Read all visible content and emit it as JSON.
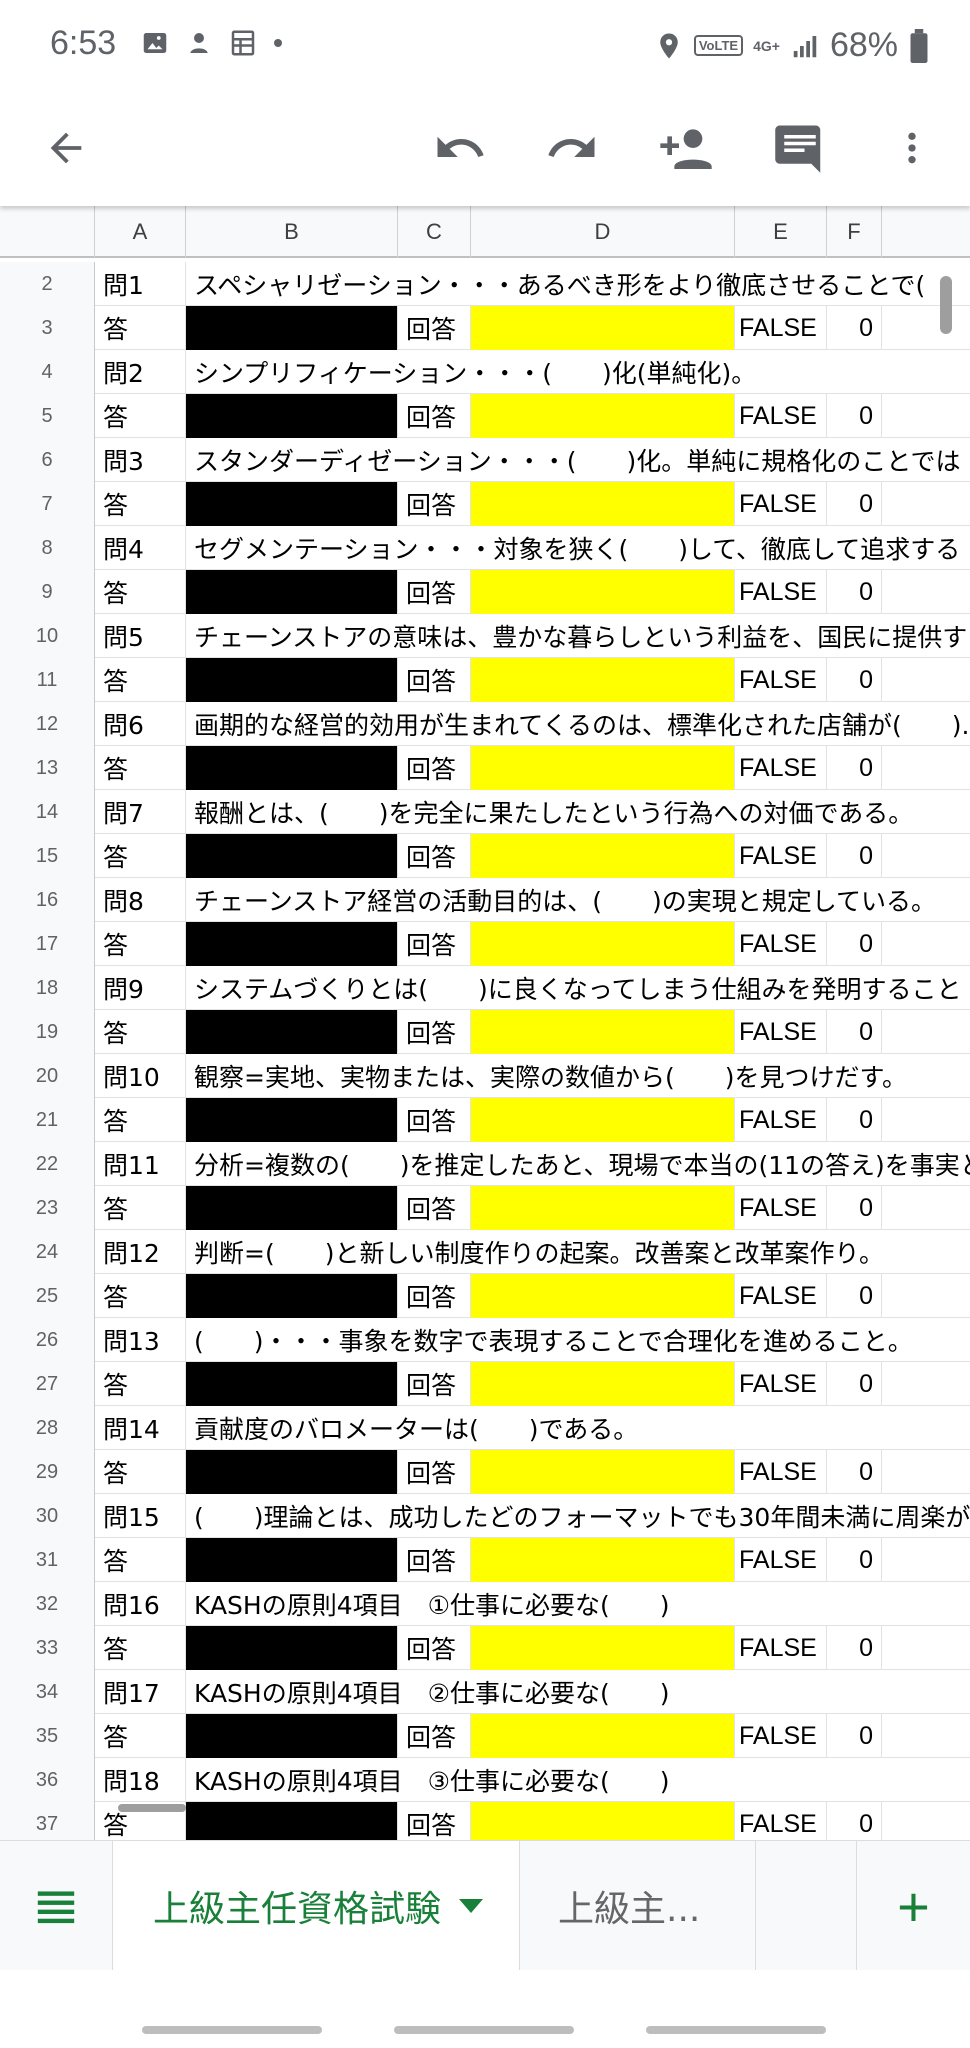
{
  "status_bar": {
    "time": "6:53",
    "volte": "VoLTE",
    "network": "4G+",
    "battery": "68%"
  },
  "columns": [
    "A",
    "B",
    "C",
    "D",
    "E",
    "F"
  ],
  "rows": [
    {
      "n": "2",
      "type": "q",
      "a": "問1",
      "text": "スペシャリゼーション・・・あるべき形をより徹底させることで("
    },
    {
      "n": "3",
      "type": "a",
      "a": "答",
      "c": "回答",
      "e": "FALSE",
      "f": "0"
    },
    {
      "n": "4",
      "type": "q",
      "a": "問2",
      "text": "シンプリフィケーション・・・(　　)化(単純化)。"
    },
    {
      "n": "5",
      "type": "a",
      "a": "答",
      "c": "回答",
      "e": "FALSE",
      "f": "0"
    },
    {
      "n": "6",
      "type": "q",
      "a": "問3",
      "text": "スタンダーディゼーション・・・(　　)化。単純に規格化のことでは"
    },
    {
      "n": "7",
      "type": "a",
      "a": "答",
      "c": "回答",
      "e": "FALSE",
      "f": "0"
    },
    {
      "n": "8",
      "type": "q",
      "a": "問4",
      "text": "セグメンテーション・・・対象を狭く(　　)して、徹底して追求する"
    },
    {
      "n": "9",
      "type": "a",
      "a": "答",
      "c": "回答",
      "e": "FALSE",
      "f": "0"
    },
    {
      "n": "10",
      "type": "q",
      "a": "問5",
      "text": "チェーンストアの意味は、豊かな暮らしという利益を、国民に提供す"
    },
    {
      "n": "11",
      "type": "a",
      "a": "答",
      "c": "回答",
      "e": "FALSE",
      "f": "0"
    },
    {
      "n": "12",
      "type": "q",
      "a": "問6",
      "text": "画期的な経営的効用が生まれてくるのは、標準化された店舗が(　　)."
    },
    {
      "n": "13",
      "type": "a",
      "a": "答",
      "c": "回答",
      "e": "FALSE",
      "f": "0"
    },
    {
      "n": "14",
      "type": "q",
      "a": "問7",
      "text": "報酬とは、(　　)を完全に果たしたという行為への対価である。"
    },
    {
      "n": "15",
      "type": "a",
      "a": "答",
      "c": "回答",
      "e": "FALSE",
      "f": "0"
    },
    {
      "n": "16",
      "type": "q",
      "a": "問8",
      "text": "チェーンストア経営の活動目的は、(　　)の実現と規定している。"
    },
    {
      "n": "17",
      "type": "a",
      "a": "答",
      "c": "回答",
      "e": "FALSE",
      "f": "0"
    },
    {
      "n": "18",
      "type": "q",
      "a": "問9",
      "text": "システムづくりとは(　　)に良くなってしまう仕組みを発明すること"
    },
    {
      "n": "19",
      "type": "a",
      "a": "答",
      "c": "回答",
      "e": "FALSE",
      "f": "0"
    },
    {
      "n": "20",
      "type": "q",
      "a": "問10",
      "text": "観察=実地、実物または、実際の数値から(　　)を見つけだす。"
    },
    {
      "n": "21",
      "type": "a",
      "a": "答",
      "c": "回答",
      "e": "FALSE",
      "f": "0"
    },
    {
      "n": "22",
      "type": "q",
      "a": "問11",
      "text": "分析=複数の(　　)を推定したあと、現場で本当の(11の答え)を事実と"
    },
    {
      "n": "23",
      "type": "a",
      "a": "答",
      "c": "回答",
      "e": "FALSE",
      "f": "0"
    },
    {
      "n": "24",
      "type": "q",
      "a": "問12",
      "text": "判断=(　　)と新しい制度作りの起案。改善案と改革案作り。"
    },
    {
      "n": "25",
      "type": "a",
      "a": "答",
      "c": "回答",
      "e": "FALSE",
      "f": "0"
    },
    {
      "n": "26",
      "type": "q",
      "a": "問13",
      "text": "(　　)・・・事象を数字で表現することで合理化を進めること。"
    },
    {
      "n": "27",
      "type": "a",
      "a": "答",
      "c": "回答",
      "e": "FALSE",
      "f": "0"
    },
    {
      "n": "28",
      "type": "q",
      "a": "問14",
      "text": "貢献度のバロメーターは(　　)である。"
    },
    {
      "n": "29",
      "type": "a",
      "a": "答",
      "c": "回答",
      "e": "FALSE",
      "f": "0"
    },
    {
      "n": "30",
      "type": "q",
      "a": "問15",
      "text": "(　　)理論とは、成功したどのフォーマットでも30年間未満に周楽が"
    },
    {
      "n": "31",
      "type": "a",
      "a": "答",
      "c": "回答",
      "e": "FALSE",
      "f": "0"
    },
    {
      "n": "32",
      "type": "q",
      "a": "問16",
      "text": "KASHの原則4項目　①仕事に必要な(　　)"
    },
    {
      "n": "33",
      "type": "a",
      "a": "答",
      "c": "回答",
      "e": "FALSE",
      "f": "0"
    },
    {
      "n": "34",
      "type": "q",
      "a": "問17",
      "text": "KASHの原則4項目　②仕事に必要な(　　)"
    },
    {
      "n": "35",
      "type": "a",
      "a": "答",
      "c": "回答",
      "e": "FALSE",
      "f": "0"
    },
    {
      "n": "36",
      "type": "q",
      "a": "問18",
      "text": "KASHの原則4項目　③仕事に必要な(　　)"
    },
    {
      "n": "37",
      "type": "a",
      "a": "答",
      "c": "回答",
      "e": "FALSE",
      "f": "0"
    }
  ],
  "tabs": {
    "active": "上級主任資格試験",
    "second": "上級主..."
  },
  "colors": {
    "accent_green": "#188038",
    "highlight_yellow": "#ffff00",
    "masked_black": "#000000"
  },
  "icons": [
    "back-arrow-icon",
    "undo-icon",
    "redo-icon",
    "add-person-icon",
    "comment-icon",
    "more-vert-icon",
    "sheet-list-icon",
    "add-sheet-icon"
  ]
}
